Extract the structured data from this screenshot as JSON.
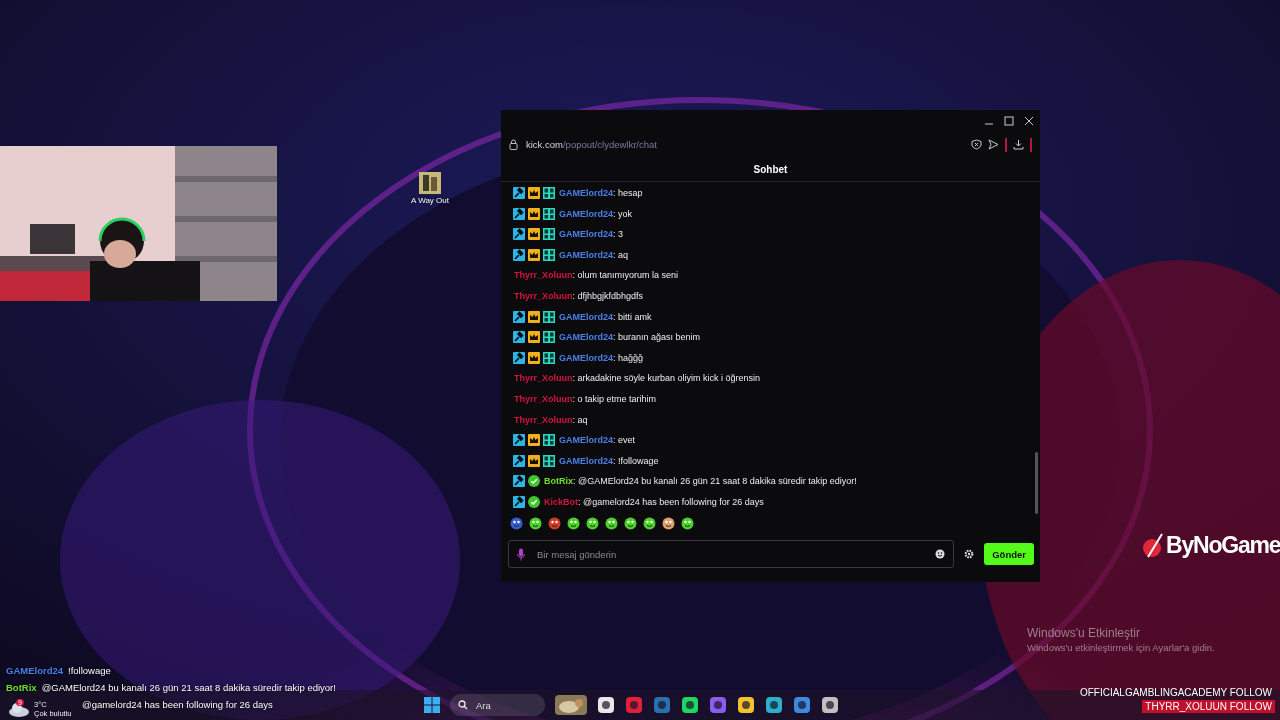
{
  "desktop_icons": [
    {
      "label": "A Way Out"
    }
  ],
  "chat_window": {
    "url_host": "kick.com",
    "url_path": "/popout/clydewlkr/chat",
    "title": "Sohbet",
    "messages": [
      {
        "kind": "subscriber",
        "user": "GAMElord24",
        "color": "#4a80e8",
        "text": ": hesap"
      },
      {
        "kind": "subscriber",
        "user": "GAMElord24",
        "color": "#4a80e8",
        "text": ": yok"
      },
      {
        "kind": "subscriber",
        "user": "GAMElord24",
        "color": "#4a80e8",
        "text": ": 3"
      },
      {
        "kind": "subscriber",
        "user": "GAMElord24",
        "color": "#4a80e8",
        "text": ": aq"
      },
      {
        "kind": "plain",
        "user": "Thyrr_Xoluun",
        "color": "#d4143f",
        "text": ": olum tanımıyorum la seni"
      },
      {
        "kind": "plain",
        "user": "Thyrr_Xoluun",
        "color": "#d4143f",
        "text": ": dfjhbgjkfdbhgdfs"
      },
      {
        "kind": "subscriber",
        "user": "GAMElord24",
        "color": "#4a80e8",
        "text": ": bitti amk"
      },
      {
        "kind": "subscriber",
        "user": "GAMElord24",
        "color": "#4a80e8",
        "text": ": buranın ağası benim"
      },
      {
        "kind": "subscriber",
        "user": "GAMElord24",
        "color": "#4a80e8",
        "text": ": haǧǧǧ"
      },
      {
        "kind": "plain",
        "user": "Thyrr_Xoluun",
        "color": "#d4143f",
        "text": ": arkadakine söyle kurban oliyim kick i öğrensin"
      },
      {
        "kind": "plain",
        "user": "Thyrr_Xoluun",
        "color": "#d4143f",
        "text": ": o takip etme tarihim"
      },
      {
        "kind": "plain",
        "user": "Thyrr_Xoluun",
        "color": "#d4143f",
        "text": ": aq"
      },
      {
        "kind": "subscriber",
        "user": "GAMElord24",
        "color": "#4a80e8",
        "text": ": evet"
      },
      {
        "kind": "subscriber",
        "user": "GAMElord24",
        "color": "#4a80e8",
        "text": ": !followage"
      },
      {
        "kind": "bot",
        "user": "BotRix",
        "color": "#6fe02a",
        "text": ": @GAMElord24 bu kanalı 26 gün 21 saat 8 dakika süredir takip ediyor!"
      },
      {
        "kind": "bot",
        "user": "KickBot",
        "color": "#d4143f",
        "text": ": @gamelord24 has been following for 26 days"
      }
    ],
    "input": {
      "placeholder": "Bir mesaj gönderin"
    },
    "send_button": "Gönder"
  },
  "sponsor_logo": "ByNoGame",
  "activation_notice": {
    "title": "Windows'u Etkinleştir",
    "subtitle": "Windows'u etkinleştirmek için Ayarlar'a gidin."
  },
  "overlay_chat": [
    {
      "user": "GAMElord24",
      "color": "#4a80e8",
      "text": "!followage"
    },
    {
      "user": "BotRix",
      "color": "#6fe02a",
      "text": "@GAMElord24 bu kanalı 26 gün 21 saat 8 dakika süredir takip ediyor!"
    },
    {
      "text": "@gamelord24 has been following for 26 days"
    }
  ],
  "weather": {
    "badge": "9",
    "temperature": "3°C",
    "condition": "Çok bulutlu"
  },
  "taskbar": {
    "search": {
      "placeholder": "Ara"
    }
  },
  "follow_alerts": [
    {
      "kind": "plain",
      "name": "OFFICIALGAMBLINGACADEMY",
      "action": "FOLLOW"
    },
    {
      "kind": "highlight",
      "name": "THYRR_XOLUUN",
      "action": "FOLLOW"
    }
  ]
}
